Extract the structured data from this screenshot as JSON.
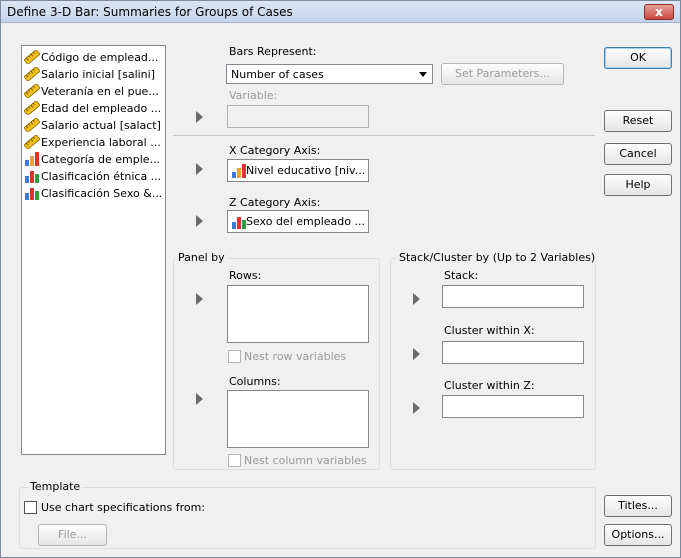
{
  "window": {
    "title": "Define 3-D Bar: Summaries for Groups of Cases",
    "close_label": "x"
  },
  "variables": [
    {
      "label": "Código de emplead...",
      "icon": "scale-ruler-icon"
    },
    {
      "label": "Salario inicial [salini]",
      "icon": "scale-ruler-icon"
    },
    {
      "label": "Veteranía en el pue...",
      "icon": "scale-ruler-icon"
    },
    {
      "label": "Edad del empleado ...",
      "icon": "scale-ruler-icon"
    },
    {
      "label": "Salario actual [salact]",
      "icon": "scale-ruler-icon"
    },
    {
      "label": "Experiencia laboral ...",
      "icon": "scale-ruler-icon"
    },
    {
      "label": "Categoría de emple...",
      "icon": "ordinal-bars-icon"
    },
    {
      "label": "Clasificación étnica ...",
      "icon": "nominal-bars-icon"
    },
    {
      "label": "Clasificación Sexo &...",
      "icon": "nominal-bars-icon"
    }
  ],
  "bars": {
    "label": "Bars Represent:",
    "selected": "Number of cases",
    "set_parameters_label": "Set Parameters...",
    "variable_label": "Variable:"
  },
  "x_axis": {
    "label": "X Category Axis:",
    "value": "Nivel educativo [niv..."
  },
  "z_axis": {
    "label": "Z Category Axis:",
    "value": "Sexo del empleado ..."
  },
  "panel_by": {
    "title": "Panel by",
    "rows_label": "Rows:",
    "nest_rows_label": "Nest row variables",
    "columns_label": "Columns:",
    "nest_columns_label": "Nest column variables"
  },
  "stack": {
    "title": "Stack/Cluster by (Up to 2 Variables)",
    "stack_label": "Stack:",
    "cluster_x_label": "Cluster within X:",
    "cluster_z_label": "Cluster within Z:"
  },
  "template": {
    "title": "Template",
    "use_spec_label": "Use chart specifications from:",
    "file_label": "File..."
  },
  "buttons": {
    "ok": "OK",
    "reset": "Reset",
    "cancel": "Cancel",
    "help": "Help",
    "titles": "Titles...",
    "options": "Options..."
  }
}
